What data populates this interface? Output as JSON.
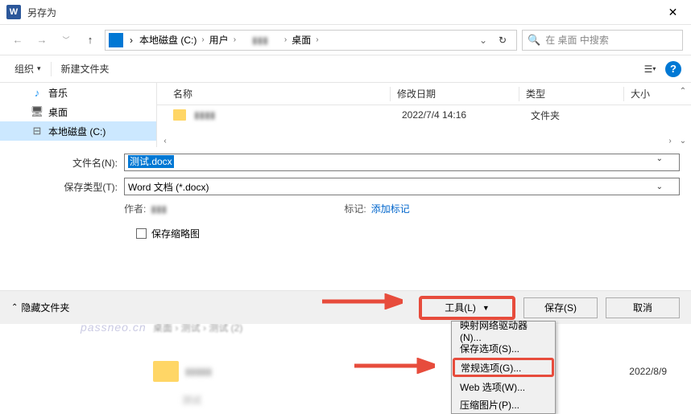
{
  "titlebar": {
    "title": "另存为"
  },
  "path": {
    "crumbs": [
      "本地磁盘 (C:)",
      "用户",
      "桌面"
    ],
    "sep": "›"
  },
  "search": {
    "placeholder": "在 桌面 中搜索"
  },
  "toolbar": {
    "organize": "组织",
    "newfolder": "新建文件夹"
  },
  "sidebar": {
    "items": [
      {
        "label": "音乐"
      },
      {
        "label": "桌面"
      },
      {
        "label": "本地磁盘 (C:)"
      }
    ]
  },
  "columns": {
    "name": "名称",
    "date": "修改日期",
    "type": "类型",
    "size": "大小"
  },
  "files": [
    {
      "date": "2022/7/4 14:16",
      "type": "文件夹"
    }
  ],
  "form": {
    "filename_label": "文件名(N):",
    "filename_value": "测试.docx",
    "filetype_label": "保存类型(T):",
    "filetype_value": "Word 文档 (*.docx)"
  },
  "meta": {
    "author_label": "作者:",
    "tag_label": "标记:",
    "tag_link": "添加标记"
  },
  "checkbox": {
    "label": "保存缩略图"
  },
  "footer": {
    "hide": "隐藏文件夹",
    "tools": "工具(L)",
    "save": "保存(S)",
    "cancel": "取消"
  },
  "dropdown": {
    "items": [
      "映射网络驱动器(N)...",
      "保存选项(S)...",
      "常规选项(G)...",
      "Web 选项(W)...",
      "压缩图片(P)..."
    ]
  },
  "watermark": "passneo.cn",
  "background": {
    "crumb": "桌面 › 测试 › 测试 (2)",
    "date": "2022/8/9"
  }
}
